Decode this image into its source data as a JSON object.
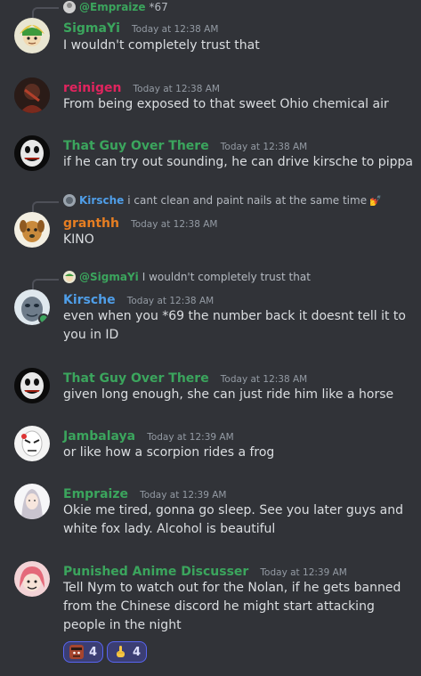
{
  "messages": [
    {
      "reply": {
        "name": "@Empraize",
        "text": "*67",
        "name_color": "#3ba55d"
      },
      "user": "SigmaYi",
      "user_color": "#3ba55d",
      "time": "Today at 12:38 AM",
      "text": "I wouldn't completely trust that",
      "avatar_icon": "link-avatar-icon"
    },
    {
      "user": "reinigen",
      "user_color": "#e0245e",
      "time": "Today at 12:38 AM",
      "text": "From being exposed to that sweet Ohio chemical air",
      "avatar_icon": "dark-figure-avatar-icon"
    },
    {
      "user": "That Guy Over There",
      "user_color": "#3ba55d",
      "time": "Today at 12:38 AM",
      "text": "if he can try out sounding, he can drive kirsche to pippa",
      "avatar_icon": "creepy-face-avatar-icon"
    },
    {
      "reply": {
        "name": "Kirsche",
        "text": "i cant clean and paint nails at the same time",
        "name_color": "#4f9ee8"
      },
      "user": "granthh",
      "user_color": "#e67e22",
      "time": "Today at 12:38 AM",
      "text": "KINO",
      "avatar_icon": "dog-avatar-icon"
    },
    {
      "reply": {
        "name": "@SigmaYi",
        "text": "I wouldn't completely trust that",
        "name_color": "#3ba55d"
      },
      "user": "Kirsche",
      "user_color": "#4f9ee8",
      "time": "Today at 12:38 AM",
      "text": "even when you *69 the number back it doesnt tell it to you in ID",
      "avatar_icon": "grey-creature-avatar-icon"
    },
    {
      "user": "That Guy Over There",
      "user_color": "#3ba55d",
      "time": "Today at 12:38 AM",
      "text": "given long enough, she can just ride him like a horse",
      "avatar_icon": "creepy-face-avatar-icon"
    },
    {
      "user": "Jambalaya",
      "user_color": "#3ba55d",
      "time": "Today at 12:39 AM",
      "text": "or like how a scorpion rides a frog",
      "avatar_icon": "white-mask-avatar-icon"
    },
    {
      "user": "Empraize",
      "user_color": "#3ba55d",
      "time": "Today at 12:39 AM",
      "text": "Okie me tired, gonna go sleep. See you later guys and white fox lady. Alcohol is beautiful",
      "avatar_icon": "anime-girl-avatar-icon"
    },
    {
      "user": "Punished Anime Discusser",
      "user_color": "#3ba55d",
      "time": "Today at 12:39 AM",
      "text": "Tell Nym to watch out for the Nolan, if he gets banned from the Chinese discord he might start attacking people in the night",
      "avatar_icon": "pink-hair-avatar-icon",
      "reactions": [
        {
          "icon": "face-emoji-icon",
          "count": "4"
        },
        {
          "icon": "pointing-hand-emoji-icon",
          "count": "4"
        }
      ]
    }
  ]
}
